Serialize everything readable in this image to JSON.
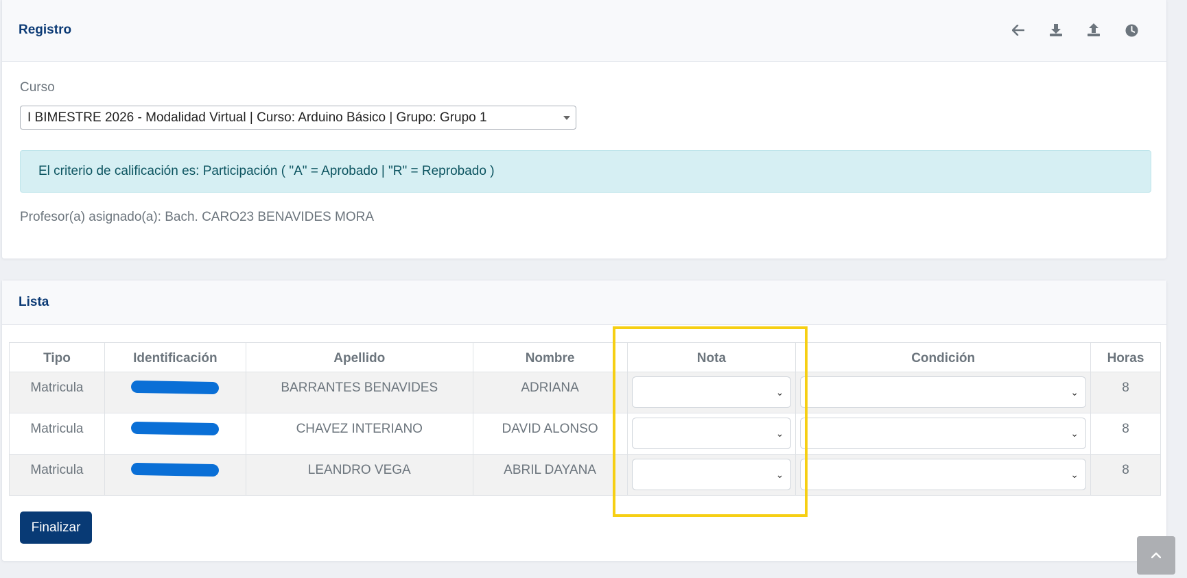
{
  "registro": {
    "title": "Registro",
    "icons": [
      "arrow-left-icon",
      "download-icon",
      "upload-icon",
      "clock-icon"
    ],
    "curso_label": "Curso",
    "curso_value": "I BIMESTRE 2026 - Modalidad Virtual | Curso: Arduino Básico | Grupo: Grupo 1",
    "alert": "El criterio de calificación es: Participación ( \"A\" = Aprobado | \"R\" = Reprobado )",
    "profesor": "Profesor(a) asignado(a): Bach. CARO23 BENAVIDES MORA"
  },
  "lista": {
    "title": "Lista",
    "headers": [
      "Tipo",
      "Identificación",
      "Apellido",
      "Nombre",
      "Nota",
      "Condición",
      "Horas"
    ],
    "rows": [
      {
        "tipo": "Matricula",
        "apellido": "BARRANTES BENAVIDES",
        "nombre": "ADRIANA",
        "nota": "",
        "condicion": "",
        "horas": "8"
      },
      {
        "tipo": "Matricula",
        "apellido": "CHAVEZ INTERIANO",
        "nombre": "DAVID ALONSO",
        "nota": "",
        "condicion": "",
        "horas": "8"
      },
      {
        "tipo": "Matricula",
        "apellido": "LEANDRO VEGA",
        "nombre": "ABRIL DAYANA",
        "nota": "",
        "condicion": "",
        "horas": "8"
      }
    ],
    "finalizar_label": "Finalizar"
  },
  "colors": {
    "primary": "#083a75",
    "title": "#0b3a75",
    "alert_bg": "#d6eff3",
    "highlight": "#f6cf13",
    "redaction": "#0a6fd6"
  }
}
